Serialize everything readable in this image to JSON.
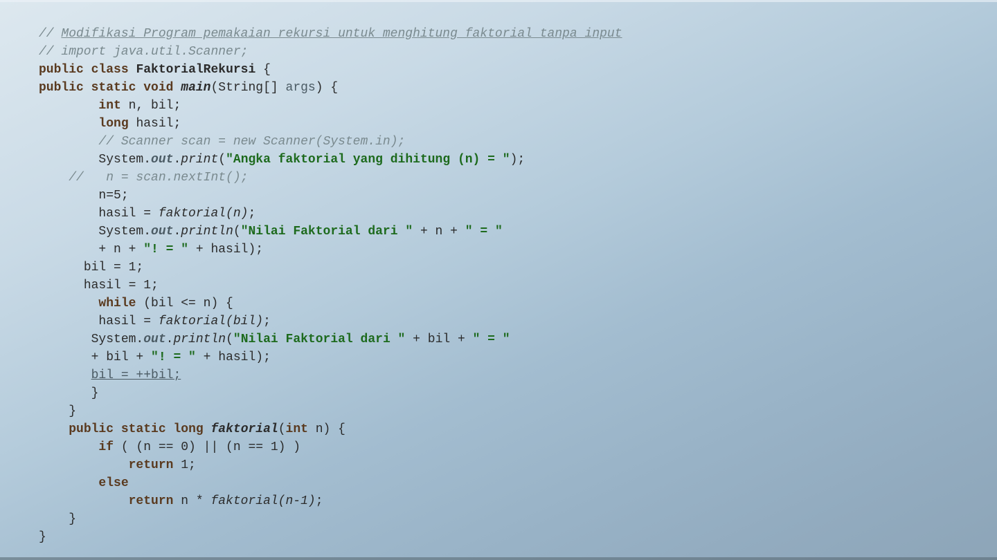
{
  "code": {
    "l01a": "// ",
    "l01b": "Modifikasi Program pemakaian rekursi untuk menghitung faktorial tanpa input",
    "l02": "// import java.util.Scanner;",
    "l03_public": "public",
    "l03_class": "class",
    "l03_name": "FaktorialRekursi",
    "l03_open": " {",
    "l04_public": "public",
    "l04_static": "static",
    "l04_void": "void",
    "l04_main": "main",
    "l04_sig": "(String[] ",
    "l04_args": "args",
    "l04_sigend": ") {",
    "l05_int": "int",
    "l05_vars": " n, bil;",
    "l06_long": "long",
    "l06_vars": " hasil;",
    "l07": "// Scanner scan = new Scanner(System.in);",
    "l08_sys": "System.",
    "l08_out": "out",
    "l08_dot": ".",
    "l08_print": "print",
    "l08_open": "(",
    "l08_str": "\"Angka faktorial yang dihitung (n) = \"",
    "l08_end": ");",
    "l09": "//   n = scan.nextInt();",
    "l10": "n=5;",
    "l11_lhs": "hasil = ",
    "l11_call": "faktorial(n)",
    "l11_end": ";",
    "l12_sys": "System.",
    "l12_out": "out",
    "l12_dot": ".",
    "l12_print": "println",
    "l12_open": "(",
    "l12_str": "\"Nilai Faktorial dari \"",
    "l12_plus": " + n + ",
    "l12_str2": "\" = \"",
    "l13_plus": "+ n + ",
    "l13_str": "\"! = \"",
    "l13_plus2": " + hasil);",
    "l14": "bil = 1;",
    "l15": "hasil = 1;",
    "l16_while": "while",
    "l16_cond": " (bil <= n) {",
    "l17_lhs": "hasil = ",
    "l17_call": "faktorial(bil)",
    "l17_end": ";",
    "l18_sys": "System.",
    "l18_out": "out",
    "l18_dot": ".",
    "l18_print": "println",
    "l18_open": "(",
    "l18_str": "\"Nilai Faktorial dari \"",
    "l18_plus": " + bil + ",
    "l18_str2": "\" = \"",
    "l19_plus": "+ bil + ",
    "l19_str": "\"! = \"",
    "l19_plus2": " + hasil);",
    "l20": "bil = ++bil;",
    "l21": "}",
    "l22": "}",
    "l23_public": "public",
    "l23_static": "static",
    "l23_long": "long",
    "l23_name": "faktorial",
    "l23_open": "(",
    "l23_int": "int",
    "l23_arg": " n",
    "l23_close": ") {",
    "l24_if": "if",
    "l24_cond": " ( (n == 0) || (n == 1) )",
    "l25_ret": "return",
    "l25_val": " 1;",
    "l26_else": "else",
    "l27_ret": "return",
    "l27_expr": " n * ",
    "l27_call": "faktorial(n-1)",
    "l27_end": ";",
    "l28": "}",
    "l29": "}"
  }
}
